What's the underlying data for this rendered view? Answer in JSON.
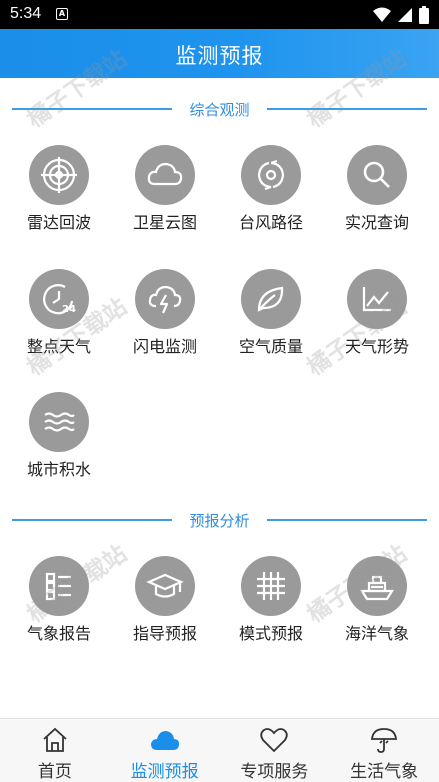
{
  "status_bar": {
    "time": "5:34",
    "notif_glyph": "A"
  },
  "header": {
    "title": "监测预报"
  },
  "sections": [
    {
      "title": "综合观测",
      "items": [
        {
          "label": "雷达回波",
          "icon": "radar-icon"
        },
        {
          "label": "卫星云图",
          "icon": "cloud-icon"
        },
        {
          "label": "台风路径",
          "icon": "typhoon-icon"
        },
        {
          "label": "实况查询",
          "icon": "search-icon"
        },
        {
          "label": "整点天气",
          "icon": "clock-24-icon"
        },
        {
          "label": "闪电监测",
          "icon": "lightning-icon"
        },
        {
          "label": "空气质量",
          "icon": "leaf-icon"
        },
        {
          "label": "天气形势",
          "icon": "trend-chart-icon"
        },
        {
          "label": "城市积水",
          "icon": "water-waves-icon"
        }
      ]
    },
    {
      "title": "预报分析",
      "items": [
        {
          "label": "气象报告",
          "icon": "report-list-icon"
        },
        {
          "label": "指导预报",
          "icon": "graduation-cap-icon"
        },
        {
          "label": "模式预报",
          "icon": "grid-icon"
        },
        {
          "label": "海洋气象",
          "icon": "ship-icon"
        }
      ]
    }
  ],
  "watermark": "橘子下载站",
  "bottom_nav": [
    {
      "label": "首页",
      "icon": "home-icon",
      "active": false
    },
    {
      "label": "监测预报",
      "icon": "cloud-filled-icon",
      "active": true
    },
    {
      "label": "专项服务",
      "icon": "heart-icon",
      "active": false
    },
    {
      "label": "生活气象",
      "icon": "umbrella-icon",
      "active": false
    }
  ],
  "colors": {
    "header": "#1a8ee8",
    "accent": "#2f8ee0",
    "icon_circle": "#9a9a9a",
    "active_tab": "#1a8ee8"
  }
}
